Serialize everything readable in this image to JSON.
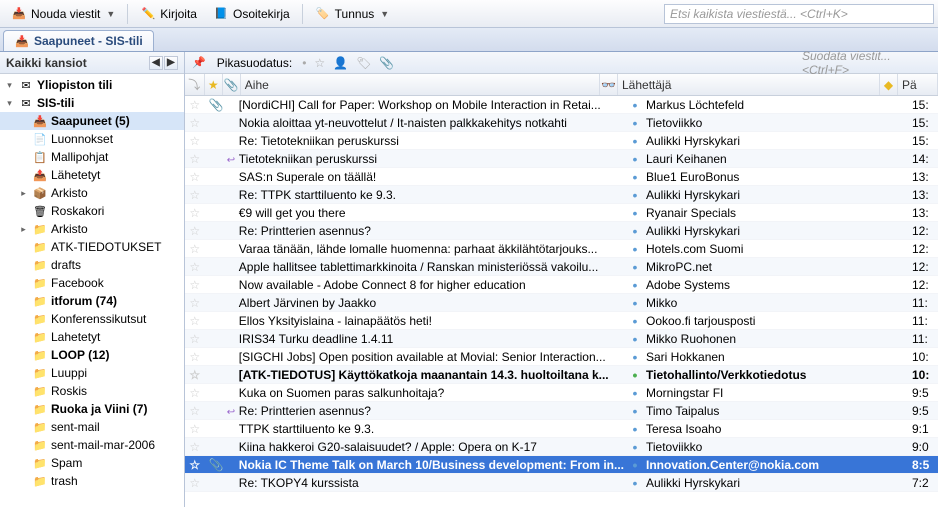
{
  "toolbar": {
    "get": "Nouda viestit",
    "write": "Kirjoita",
    "address": "Osoitekirja",
    "tag": "Tunnus",
    "search_ph": "Etsi kaikista viestiestä... <Ctrl+K>"
  },
  "tab": {
    "label": "Saapuneet - SIS-tili"
  },
  "sidebar": {
    "header": "Kaikki kansiot",
    "items": [
      {
        "tw": "▾",
        "icon": "mail",
        "label": "Yliopiston tili",
        "bold": true,
        "ind": 0
      },
      {
        "tw": "▾",
        "icon": "mail",
        "label": "SIS-tili",
        "bold": true,
        "ind": 0
      },
      {
        "tw": "",
        "icon": "inbox",
        "label": "Saapuneet (5)",
        "bold": true,
        "ind": 1,
        "sel": true
      },
      {
        "tw": "",
        "icon": "file",
        "label": "Luonnokset",
        "ind": 1
      },
      {
        "tw": "",
        "icon": "tmpl",
        "label": "Mallipohjat",
        "ind": 1
      },
      {
        "tw": "",
        "icon": "sent",
        "label": "Lähetetyt",
        "ind": 1
      },
      {
        "tw": "▸",
        "icon": "arch",
        "label": "Arkisto",
        "ind": 1
      },
      {
        "tw": "",
        "icon": "trash",
        "label": "Roskakori",
        "ind": 1
      },
      {
        "tw": "▸",
        "icon": "fld",
        "label": "Arkisto",
        "ind": 1
      },
      {
        "tw": "",
        "icon": "fld",
        "label": "ATK-TIEDOTUKSET",
        "ind": 1
      },
      {
        "tw": "",
        "icon": "fld",
        "label": "drafts",
        "ind": 1
      },
      {
        "tw": "",
        "icon": "fld",
        "label": "Facebook",
        "ind": 1
      },
      {
        "tw": "",
        "icon": "fld",
        "label": "itforum (74)",
        "bold": true,
        "ind": 1
      },
      {
        "tw": "",
        "icon": "fld",
        "label": "Konferenssikutsut",
        "ind": 1
      },
      {
        "tw": "",
        "icon": "fld",
        "label": "Lahetetyt",
        "ind": 1
      },
      {
        "tw": "",
        "icon": "fld",
        "label": "LOOP (12)",
        "bold": true,
        "ind": 1
      },
      {
        "tw": "",
        "icon": "fld",
        "label": "Luuppi",
        "ind": 1
      },
      {
        "tw": "",
        "icon": "fld",
        "label": "Roskis",
        "ind": 1
      },
      {
        "tw": "",
        "icon": "fld",
        "label": "Ruoka ja Viini (7)",
        "bold": true,
        "ind": 1
      },
      {
        "tw": "",
        "icon": "fld",
        "label": "sent-mail",
        "ind": 1
      },
      {
        "tw": "",
        "icon": "fld",
        "label": "sent-mail-mar-2006",
        "ind": 1
      },
      {
        "tw": "",
        "icon": "fld",
        "label": "Spam",
        "ind": 1
      },
      {
        "tw": "",
        "icon": "fld",
        "label": "trash",
        "ind": 1
      }
    ]
  },
  "quick": {
    "label": "Pikasuodatus:",
    "filter_ph": "Suodata viestit... <Ctrl+F>"
  },
  "columns": {
    "subject": "Aihe",
    "sender": "Lähettäjä",
    "time": "Pä"
  },
  "messages": [
    {
      "att": true,
      "subj": "[NordiCHI] Call for Paper: Workshop on Mobile Interaction in Retai...",
      "snd": "Markus Löchtefeld",
      "tm": "15:",
      "dot": "•"
    },
    {
      "subj": "Nokia aloittaa yt-neuvottelut / It-naisten palkkakehitys notkahti",
      "snd": "Tietoviikko",
      "tm": "15:",
      "dot": "•"
    },
    {
      "subj": "Re: Tietotekniikan peruskurssi",
      "snd": "Aulikki Hyrskykari",
      "tm": "15:",
      "dot": "•"
    },
    {
      "reply": true,
      "subj": "Tietotekniikan peruskurssi",
      "snd": "Lauri Keihanen",
      "tm": "14:",
      "dot": "•"
    },
    {
      "subj": "SAS:n Superale on täällä!",
      "snd": "Blue1 EuroBonus",
      "tm": "13:",
      "dot": "•"
    },
    {
      "subj": "Re: TTPK starttiluento ke 9.3.",
      "snd": "Aulikki Hyrskykari",
      "tm": "13:",
      "dot": "•"
    },
    {
      "subj": "€9 will get you there",
      "snd": "Ryanair Specials",
      "tm": "13:",
      "dot": "•"
    },
    {
      "subj": "Re: Printterien asennus?",
      "snd": "Aulikki Hyrskykari",
      "tm": "12:",
      "dot": "•"
    },
    {
      "subj": "Varaa tänään, lähde lomalle huomenna: parhaat äkkilähtötarjouks...",
      "snd": "Hotels.com Suomi",
      "tm": "12:",
      "dot": "•"
    },
    {
      "subj": "Apple hallitsee tablettimarkkinoita / Ranskan ministeriössä vakoilu...",
      "snd": "MikroPC.net",
      "tm": "12:",
      "dot": "•"
    },
    {
      "subj": "Now available - Adobe Connect 8 for higher education",
      "snd": "Adobe Systems",
      "tm": "12:",
      "dot": "•"
    },
    {
      "subj": "Albert Järvinen by Jaakko",
      "snd": "Mikko",
      "tm": "11:",
      "dot": "•"
    },
    {
      "subj": "Ellos Yksityislaina - lainapäätös heti!",
      "snd": "Ookoo.fi tarjousposti",
      "tm": "11:",
      "dot": "•"
    },
    {
      "subj": "IRIS34 Turku deadline 1.4.11",
      "snd": "Mikko Ruohonen",
      "tm": "11:",
      "dot": "•"
    },
    {
      "subj": "[SIGCHI Jobs] Open position available at Movial: Senior Interaction...",
      "snd": "Sari Hokkanen",
      "tm": "10:",
      "dot": "•"
    },
    {
      "bold": true,
      "subj": "[ATK-TIEDOTUS] Käyttökatkoja maanantain 14.3. huoltoiltana k...",
      "snd": "Tietohallinto/Verkkotiedotus",
      "tm": "10:",
      "dot": "•",
      "dotg": true
    },
    {
      "subj": "Kuka on Suomen paras salkunhoitaja?",
      "snd": "Morningstar FI",
      "tm": "9:5",
      "dot": "•"
    },
    {
      "reply": true,
      "subj": "Re: Printterien asennus?",
      "snd": "Timo Taipalus",
      "tm": "9:5",
      "dot": "•"
    },
    {
      "subj": "TTPK starttiluento ke 9.3.",
      "snd": "Teresa Isoaho",
      "tm": "9:1",
      "dot": "•"
    },
    {
      "subj": "Kiina hakkeroi G20-salaisuudet? / Apple: Opera on K-17",
      "snd": "Tietoviikko",
      "tm": "9:0",
      "dot": "•"
    },
    {
      "sel": true,
      "bold": true,
      "att": true,
      "subj": "Nokia IC Theme Talk on March 10/Business development: From in...",
      "snd": "Innovation.Center@nokia.com",
      "tm": "8:5",
      "dot": "•"
    },
    {
      "subj": "Re: TKOPY4 kurssista",
      "snd": "Aulikki Hyrskykari",
      "tm": "7:2",
      "dot": "•"
    }
  ]
}
